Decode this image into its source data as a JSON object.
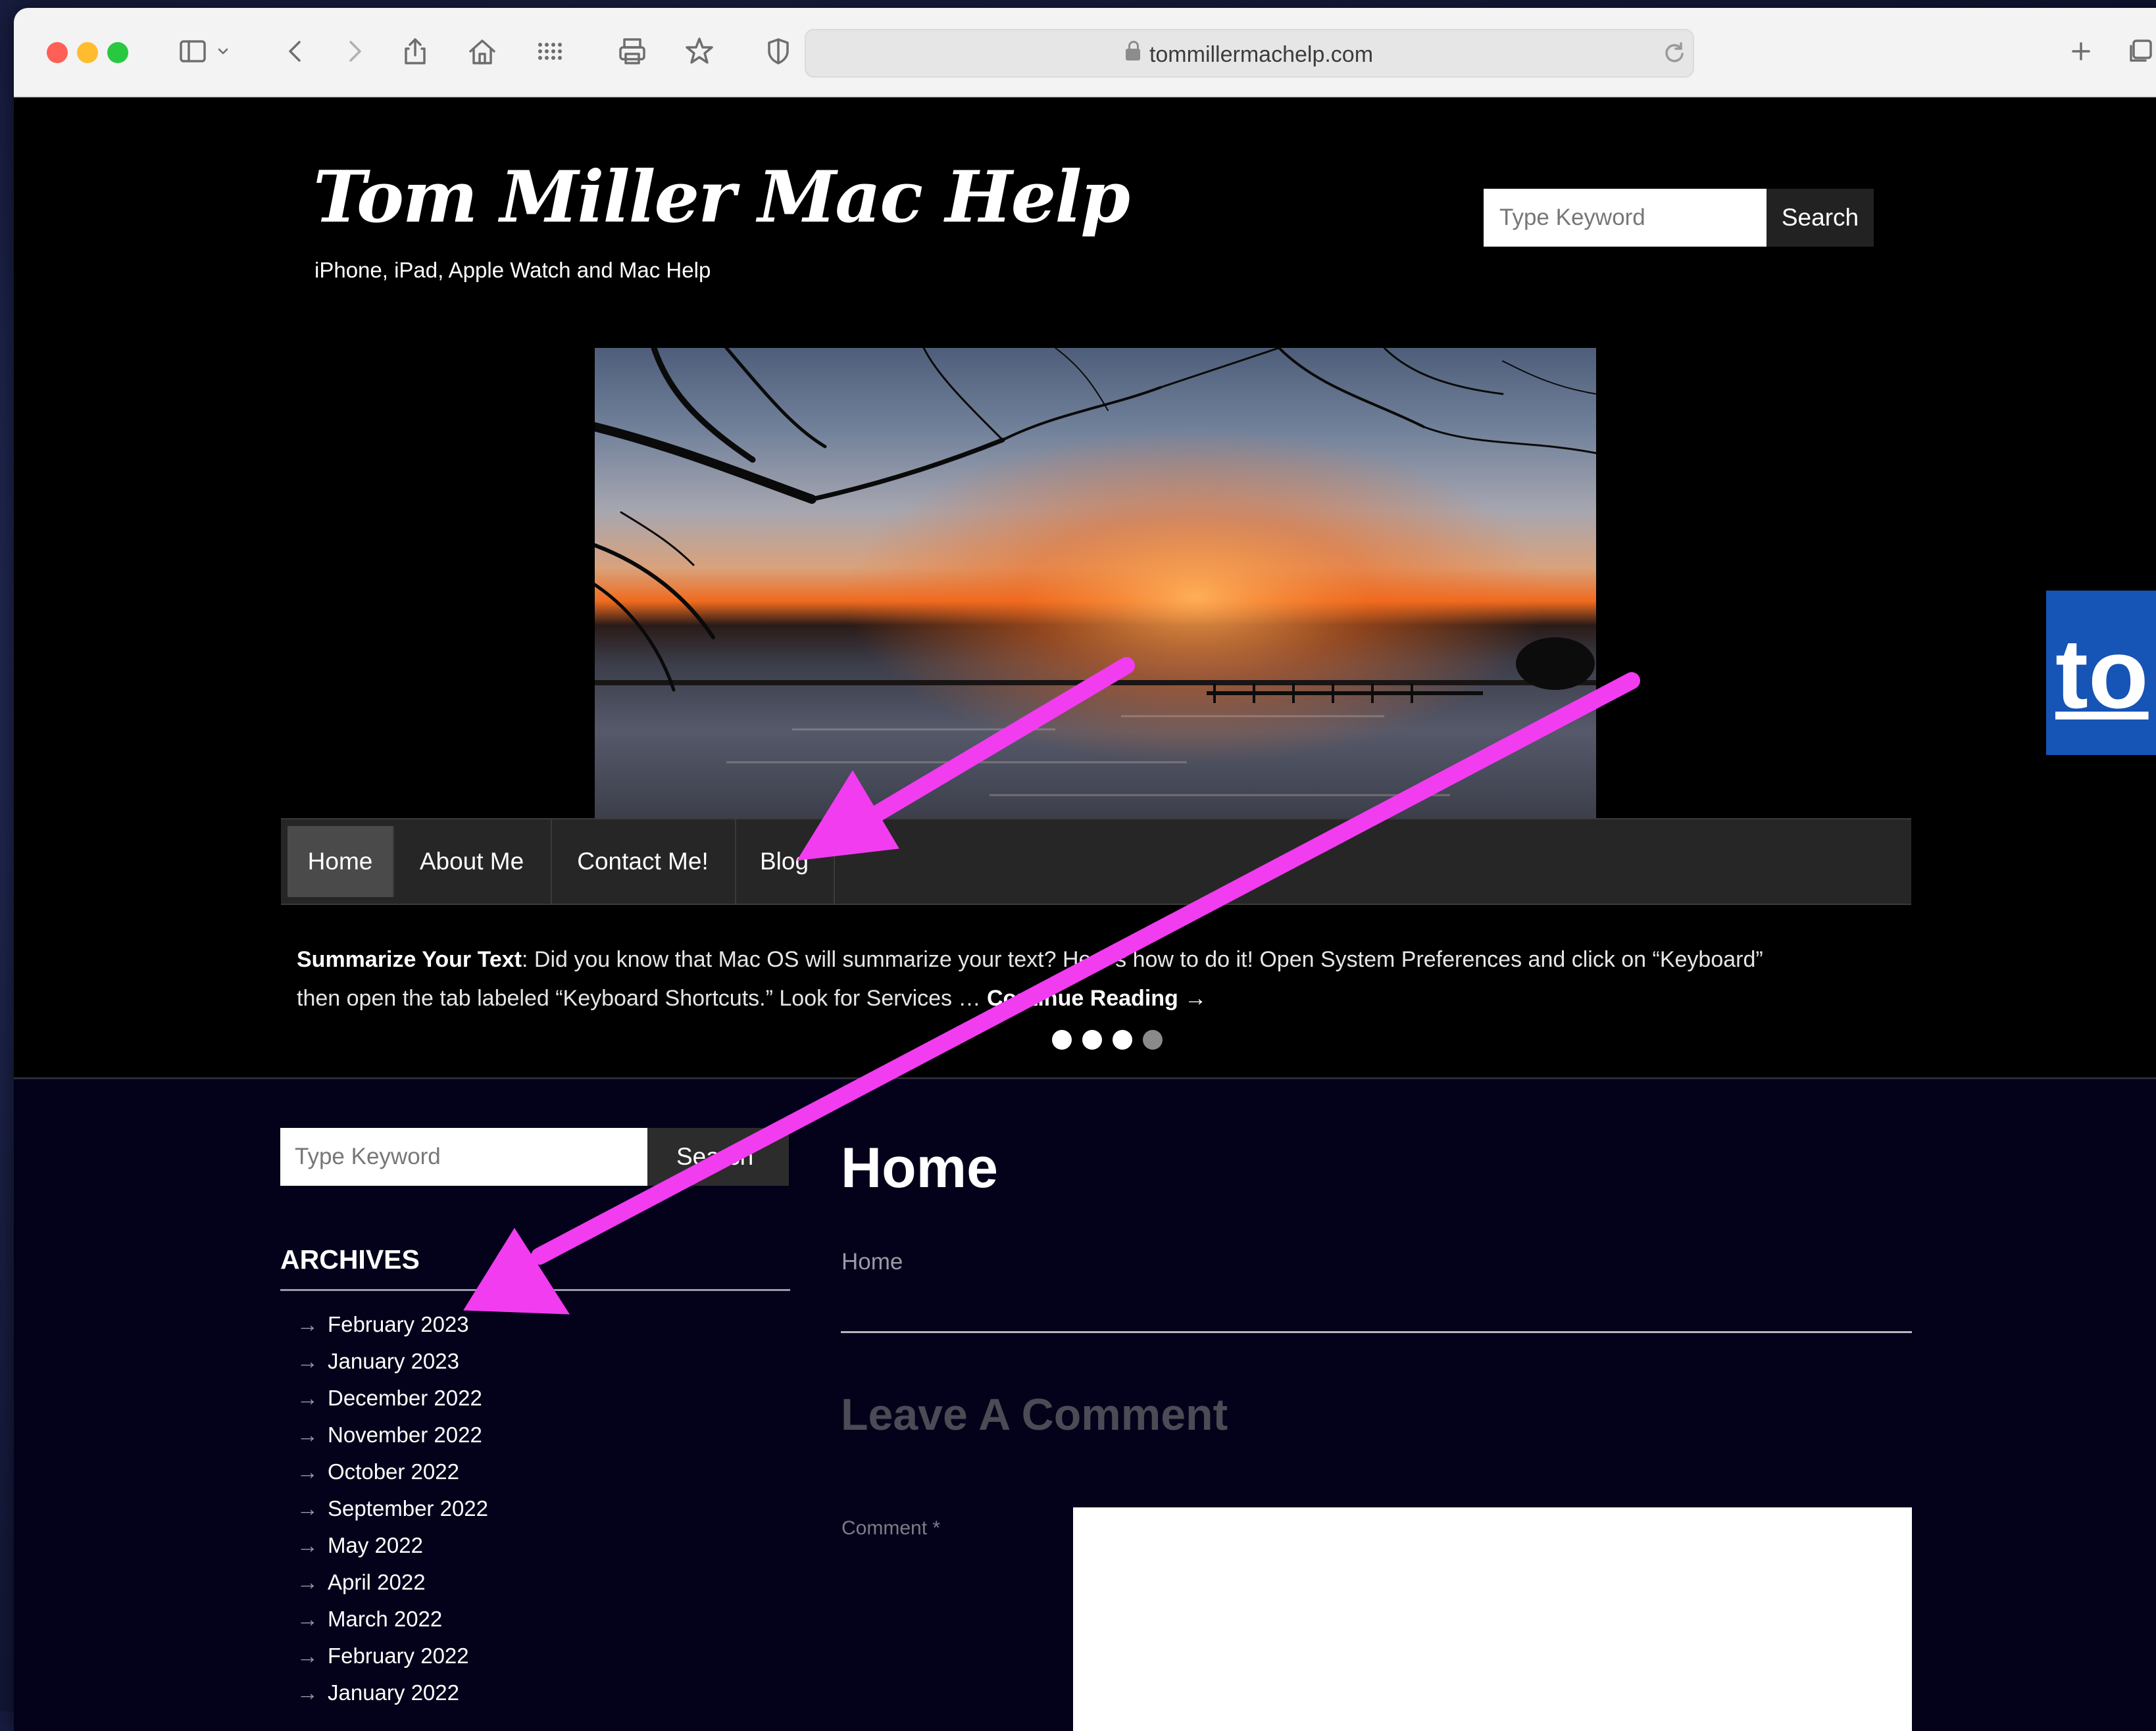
{
  "browser": {
    "url": "tommillermachelp.com"
  },
  "header": {
    "site_title": "Tom Miller Mac Help",
    "tagline": "iPhone, iPad, Apple Watch and Mac Help",
    "search_placeholder": "Type Keyword",
    "search_button": "Search"
  },
  "nav": {
    "items": [
      {
        "label": "Home",
        "active": true
      },
      {
        "label": "About Me"
      },
      {
        "label": "Contact Me!"
      },
      {
        "label": "Blog"
      }
    ]
  },
  "teaser": {
    "title": "Summarize Your Text",
    "text_part1": ": Did you know that Mac OS will summarize your text? Here's how to do it! Open System Preferences and click on “Keyboard”",
    "text_part2": "then open the tab labeled “Keyboard Shortcuts.” Look for Services … ",
    "more_link": "Continue Reading →",
    "slides": 4,
    "active_slide": 4
  },
  "sidebar": {
    "search_placeholder": "Type Keyword",
    "search_button": "Search",
    "archives_title": "ARCHIVES",
    "archives": [
      "February 2023",
      "January 2023",
      "December 2022",
      "November 2022",
      "October 2022",
      "September 2022",
      "May 2022",
      "April 2022",
      "March 2022",
      "February 2022",
      "January 2022"
    ]
  },
  "main": {
    "page_title": "Home",
    "breadcrumb": "Home",
    "comment_heading": "Leave A Comment",
    "comment_label": "Comment *"
  },
  "side_badge": "to",
  "colors": {
    "annotation_arrow": "#f23cf0",
    "content_bg": "#03021a",
    "nav_bg": "#262626"
  }
}
